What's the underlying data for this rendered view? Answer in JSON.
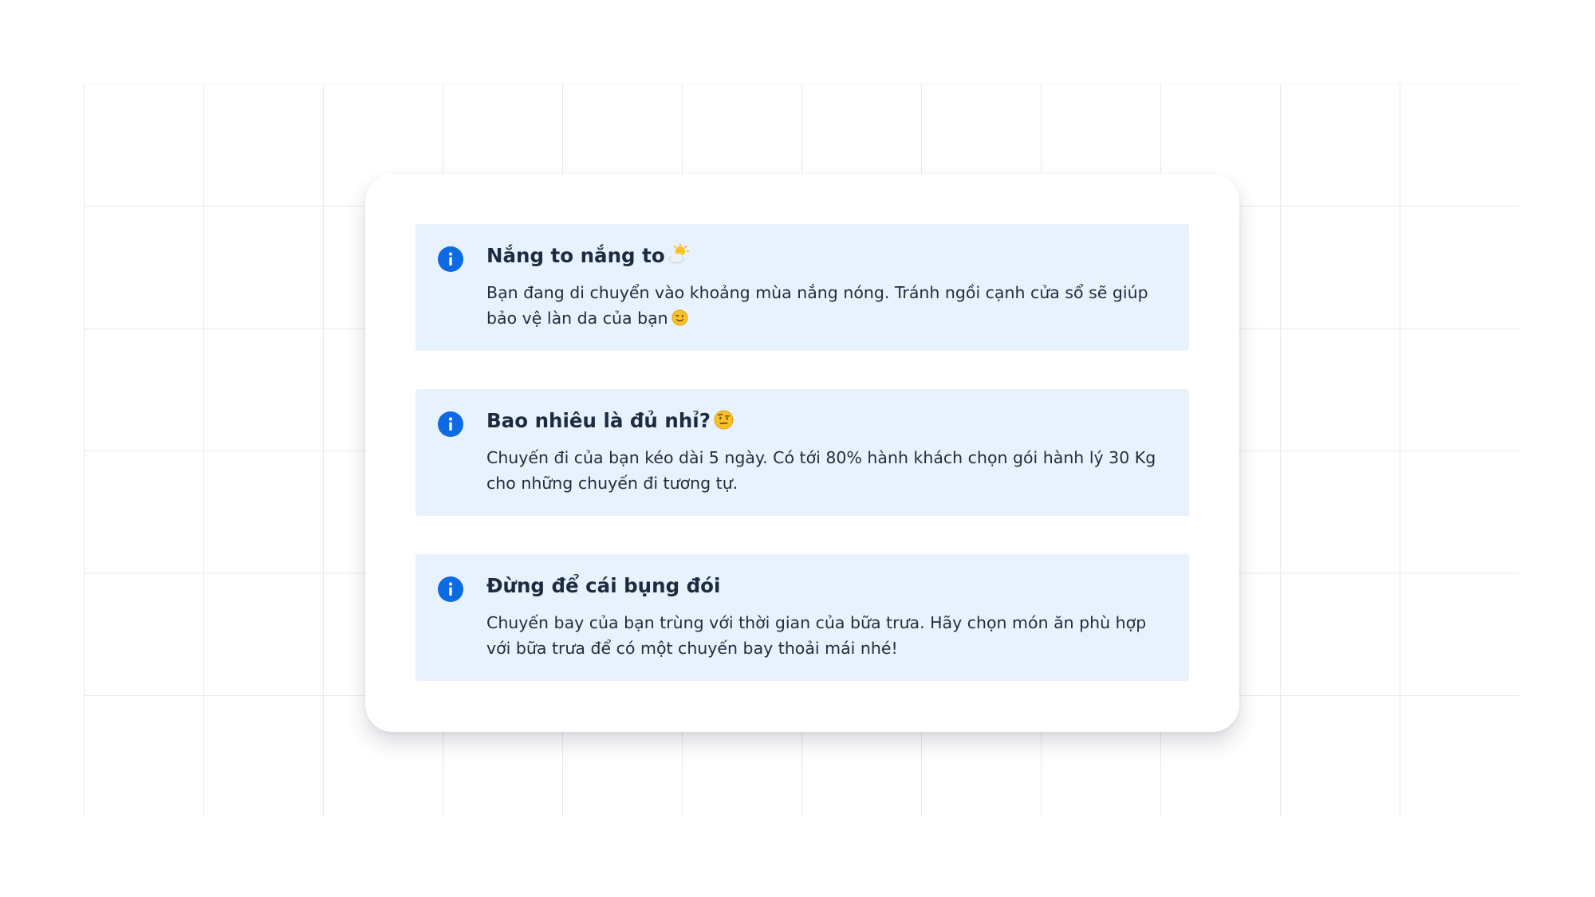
{
  "colors": {
    "card_background": "#ffffff",
    "notice_background": "#e8f2fd",
    "info_icon": "#0c6ae3",
    "title_text": "#1c2b40",
    "body_text": "#1f2d3d",
    "grid_lines": "#e7e9ee"
  },
  "notices": [
    {
      "icon": "info-icon",
      "title": "Nắng to nắng to",
      "title_emoji": "sun-behind-cloud",
      "text": "Bạn đang di chuyển vào khoảng mùa nắng nóng. Tránh ngồi cạnh cửa sổ sẽ giúp bảo vệ làn da của bạn",
      "text_emoji": "winking-face"
    },
    {
      "icon": "info-icon",
      "title": "Bao nhiêu là đủ nhỉ?",
      "title_emoji": "face-with-raised-eyebrow",
      "text": "Chuyến đi của bạn kéo dài 5 ngày. Có tới 80% hành khách chọn gói hành lý 30 Kg cho những chuyến đi tương tự."
    },
    {
      "icon": "info-icon",
      "title": "Đừng để cái bụng đói",
      "text": "Chuyến bay của bạn trùng với thời gian của bữa trưa. Hãy chọn món ăn phù hợp với bữa trưa để có một chuyến bay thoải mái nhé!"
    }
  ]
}
